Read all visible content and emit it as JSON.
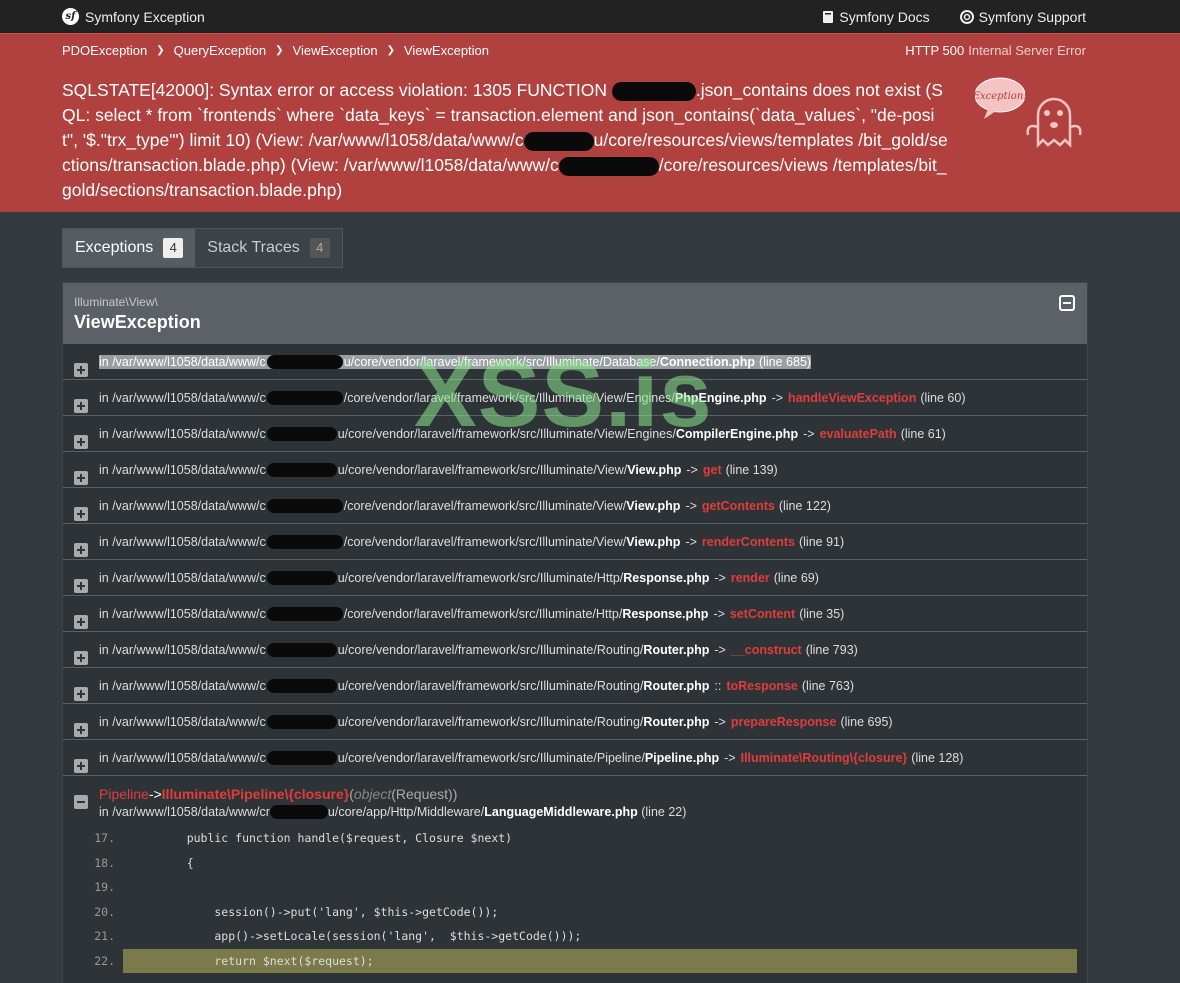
{
  "topbar": {
    "brand": "Symfony Exception",
    "docs_label": "Symfony Docs",
    "support_label": "Symfony Support"
  },
  "breadcrumbs": [
    "PDOException",
    "QueryException",
    "ViewException",
    "ViewException"
  ],
  "status": {
    "code": "HTTP 500",
    "text": "Internal Server Error"
  },
  "message": {
    "part1": "SQLSTATE[42000]: Syntax error or access violation: 1305 FUNCTION ",
    "part2": ".json_contains does not exist (SQL: select * from `frontends` where `data_keys` = transaction.element and json_contains(`data_values`, \"de-posit\", '$.\"trx_type\"') limit 10) (View: /var/www/l1058/data/www/c",
    "part3": "u/core/resources/views/templates /bit_gold/sections/transaction.blade.php) (View: /var/www/l1058/data/www/c",
    "part4": "/core/resources/views /templates/bit_gold/sections/transaction.blade.php)"
  },
  "illustration_text": "Exception!",
  "tabs": [
    {
      "label": "Exceptions",
      "count": "4"
    },
    {
      "label": "Stack Traces",
      "count": "4"
    }
  ],
  "exception": {
    "namespace": "Illuminate\\View\\",
    "class": "ViewException"
  },
  "trace": [
    {
      "pre": "in /var/www/l1058/data/www/c",
      "post": "u/core/vendor/laravel/framework/src/Illuminate/Database/",
      "file": "Connection.php",
      "arrow": "",
      "fn": "",
      "line": "(line 685)"
    },
    {
      "pre": "in /var/www/l1058/data/www/c",
      "post": "/core/vendor/laravel/framework/src/Illuminate/View/Engines/",
      "file": "PhpEngine.php",
      "arrow": "->",
      "fn": "handleViewException",
      "line": "(line 60)"
    },
    {
      "pre": "in /var/www/l1058/data/www/c",
      "post": "u/core/vendor/laravel/framework/src/Illuminate/View/Engines/",
      "file": "CompilerEngine.php",
      "arrow": "->",
      "fn": "evaluatePath",
      "line": "(line 61)"
    },
    {
      "pre": "in /var/www/l1058/data/www/c",
      "post": "u/core/vendor/laravel/framework/src/Illuminate/View/",
      "file": "View.php",
      "arrow": "->",
      "fn": "get",
      "line": "(line 139)"
    },
    {
      "pre": "in /var/www/l1058/data/www/c",
      "post": "/core/vendor/laravel/framework/src/Illuminate/View/",
      "file": "View.php",
      "arrow": "->",
      "fn": "getContents",
      "line": "(line 122)"
    },
    {
      "pre": "in /var/www/l1058/data/www/c",
      "post": "/core/vendor/laravel/framework/src/Illuminate/View/",
      "file": "View.php",
      "arrow": "->",
      "fn": "renderContents",
      "line": "(line 91)"
    },
    {
      "pre": "in /var/www/l1058/data/www/c",
      "post": "u/core/vendor/laravel/framework/src/Illuminate/Http/",
      "file": "Response.php",
      "arrow": "->",
      "fn": "render",
      "line": "(line 69)"
    },
    {
      "pre": "in /var/www/l1058/data/www/c",
      "post": "/core/vendor/laravel/framework/src/Illuminate/Http/",
      "file": "Response.php",
      "arrow": "->",
      "fn": "setContent",
      "line": "(line 35)"
    },
    {
      "pre": "in /var/www/l1058/data/www/c",
      "post": "u/core/vendor/laravel/framework/src/Illuminate/Routing/",
      "file": "Router.php",
      "arrow": "->",
      "fn": "__construct",
      "line": "(line 793)"
    },
    {
      "pre": "in /var/www/l1058/data/www/c",
      "post": "u/core/vendor/laravel/framework/src/Illuminate/Routing/",
      "file": "Router.php",
      "arrow": "::",
      "fn": "toResponse",
      "line": "(line 763)"
    },
    {
      "pre": "in /var/www/l1058/data/www/c",
      "post": "u/core/vendor/laravel/framework/src/Illuminate/Routing/",
      "file": "Router.php",
      "arrow": "->",
      "fn": "prepareResponse",
      "line": "(line 695)"
    },
    {
      "pre": "in /var/www/l1058/data/www/c",
      "post": "u/core/vendor/laravel/framework/src/Illuminate/Pipeline/",
      "file": "Pipeline.php",
      "arrow": "->",
      "fn": "Illuminate\\Routing\\{closure}",
      "line": "(line 128)"
    }
  ],
  "expanded_frame": {
    "class": "Pipeline",
    "arrow": "->",
    "fn": "Illuminate\\Pipeline\\{closure}",
    "args_open": "(",
    "args_type": "object",
    "args_val": "(Request))",
    "path_pre": "in /var/www/l1058/data/www/cr",
    "path_post": "u/core/app/Http/Middleware/",
    "file": "LanguageMiddleware.php",
    "line": "(line 22)"
  },
  "code": [
    {
      "n": "17.",
      "text": "    public function handle($request, Closure $next)"
    },
    {
      "n": "18.",
      "text": "    {"
    },
    {
      "n": "19.",
      "text": ""
    },
    {
      "n": "20.",
      "text": "        session()->put('lang', $this->getCode());"
    },
    {
      "n": "21.",
      "text": "        app()->setLocale(session('lang',  $this->getCode()));"
    },
    {
      "n": "22.",
      "text": "        return $next($request);"
    }
  ],
  "watermark": "XSS.is"
}
